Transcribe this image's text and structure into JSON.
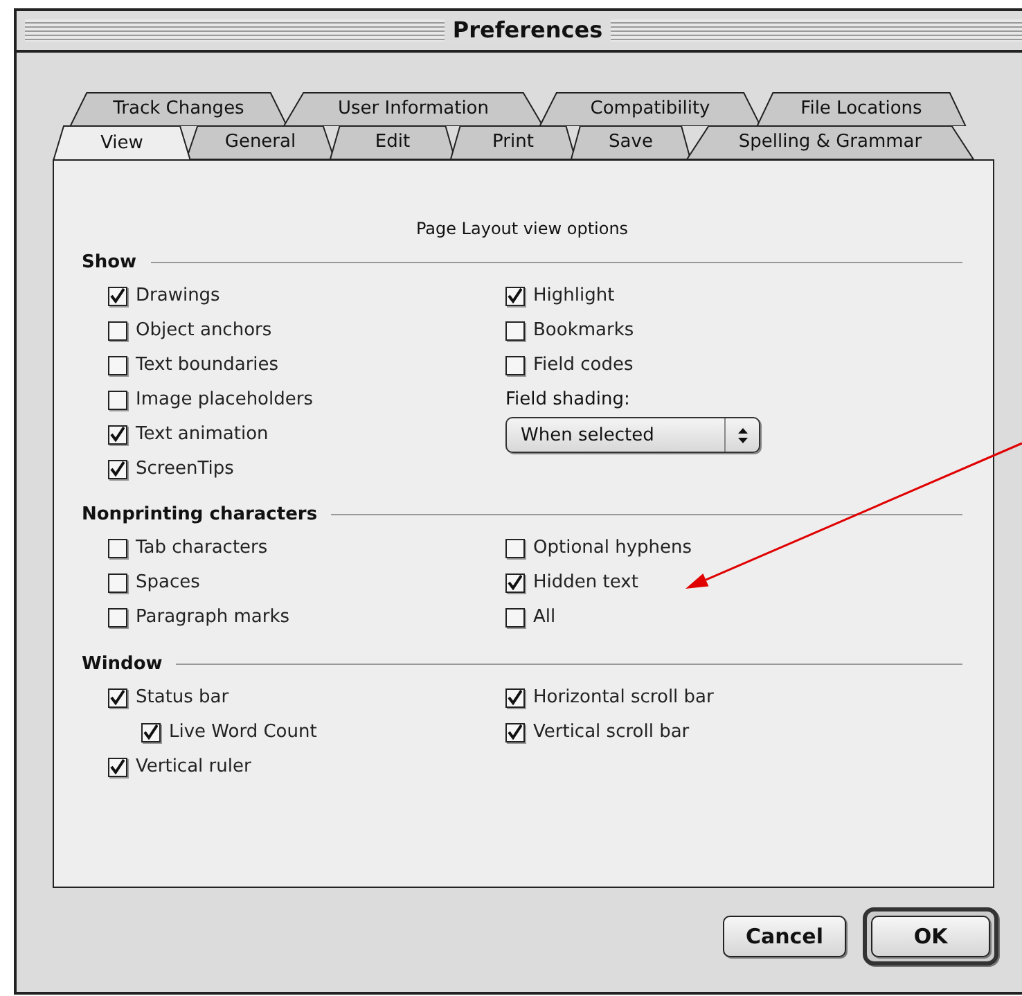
{
  "window": {
    "title": "Preferences"
  },
  "tab_rows": [
    [
      {
        "label": "Track Changes",
        "selected": false
      },
      {
        "label": "User Information",
        "selected": false
      },
      {
        "label": "Compatibility",
        "selected": false
      },
      {
        "label": "File Locations",
        "selected": false
      }
    ],
    [
      {
        "label": "View",
        "selected": true
      },
      {
        "label": "General",
        "selected": false
      },
      {
        "label": "Edit",
        "selected": false
      },
      {
        "label": "Print",
        "selected": false
      },
      {
        "label": "Save",
        "selected": false
      },
      {
        "label": "Spelling & Grammar",
        "selected": false
      }
    ]
  ],
  "caption": "Page Layout view options",
  "sections": [
    {
      "title": "Show",
      "left": [
        {
          "kind": "checkbox",
          "label": "Drawings",
          "checked": true
        },
        {
          "kind": "checkbox",
          "label": "Object anchors",
          "checked": false
        },
        {
          "kind": "checkbox",
          "label": "Text boundaries",
          "checked": false
        },
        {
          "kind": "checkbox",
          "label": "Image placeholders",
          "checked": false
        },
        {
          "kind": "checkbox",
          "label": "Text animation",
          "checked": true
        },
        {
          "kind": "checkbox",
          "label": "ScreenTips",
          "checked": true
        }
      ],
      "right": [
        {
          "kind": "checkbox",
          "label": "Highlight",
          "checked": true
        },
        {
          "kind": "checkbox",
          "label": "Bookmarks",
          "checked": false
        },
        {
          "kind": "checkbox",
          "label": "Field codes",
          "checked": false
        },
        {
          "kind": "label",
          "label": "Field shading:"
        },
        {
          "kind": "dropdown",
          "value": "When selected"
        }
      ]
    },
    {
      "title": "Nonprinting characters",
      "left": [
        {
          "kind": "checkbox",
          "label": "Tab characters",
          "checked": false
        },
        {
          "kind": "checkbox",
          "label": "Spaces",
          "checked": false
        },
        {
          "kind": "checkbox",
          "label": "Paragraph marks",
          "checked": false
        }
      ],
      "right": [
        {
          "kind": "checkbox",
          "label": "Optional hyphens",
          "checked": false
        },
        {
          "kind": "checkbox",
          "label": "Hidden text",
          "checked": true
        },
        {
          "kind": "checkbox",
          "label": "All",
          "checked": false
        }
      ]
    },
    {
      "title": "Window",
      "left": [
        {
          "kind": "checkbox",
          "label": "Status bar",
          "checked": true,
          "children": [
            {
              "kind": "checkbox",
              "label": "Live Word Count",
              "checked": true
            }
          ]
        },
        {
          "kind": "checkbox",
          "label": "Vertical ruler",
          "checked": true
        }
      ],
      "right": [
        {
          "kind": "checkbox",
          "label": "Horizontal scroll bar",
          "checked": true
        },
        {
          "kind": "checkbox",
          "label": "Vertical scroll bar",
          "checked": true
        }
      ]
    }
  ],
  "buttons": [
    {
      "label": "Cancel",
      "default": false
    },
    {
      "label": "OK",
      "default": true
    }
  ],
  "annotations": [
    {
      "kind": "arrow"
    }
  ]
}
